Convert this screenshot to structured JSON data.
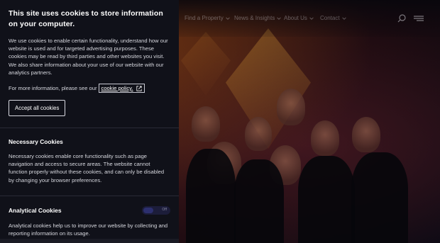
{
  "cookie_banner": {
    "title": "This site uses cookies to store information on your computer.",
    "intro": "We use cookies to enable certain functionality, understand how our website is used and for targeted advertising purposes. These cookies may be read by third parties and other websites you visit. We also share information about your use of our website with our analytics partners.",
    "policy_prefix": "For more information, please see our",
    "policy_link": "cookie policy.",
    "accept_button": "Accept all cookies",
    "sections": [
      {
        "title": "Necessary Cookies",
        "text": "Necessary cookies enable core functionality such as page navigation and access to secure areas. The website cannot function properly without these cookies, and can only be disabled by changing your browser preferences."
      },
      {
        "title": "Analytical Cookies",
        "toggle_label": "Off",
        "text": "Analytical cookies help us to improve our website by collecting and reporting information on its usage."
      }
    ]
  },
  "nav": {
    "items": [
      "Find a Property",
      "News & Insights",
      "About Us",
      "Contact"
    ],
    "icons": [
      "search-icon",
      "menu-icon"
    ]
  },
  "colors": {
    "panel_bg": "#101119",
    "text": "#ffffff"
  }
}
